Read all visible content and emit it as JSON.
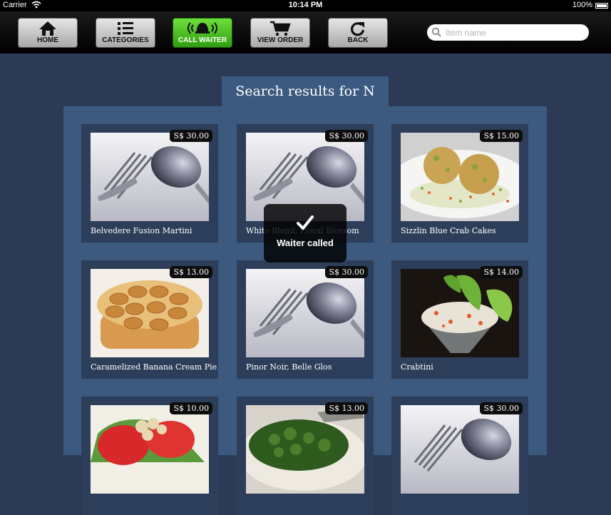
{
  "status_bar": {
    "carrier": "Carrier",
    "time": "10:14 PM",
    "battery": "100%"
  },
  "toolbar": {
    "home": "HOME",
    "categories": "CATEGORIES",
    "call_waiter": "CALL WAITER",
    "view_order": "VIEW ORDER",
    "back": "BACK"
  },
  "search": {
    "placeholder": "Item name"
  },
  "results": {
    "title": "Search results for N",
    "items": [
      {
        "name": "Belvedere Fusion Martini",
        "price": "S$ 30.00"
      },
      {
        "name": "White Blend, Floral Blossom",
        "price": "S$ 30.00"
      },
      {
        "name": "Sizzlin Blue Crab Cakes",
        "price": "S$ 15.00"
      },
      {
        "name": "Caramelized Banana Cream Pie",
        "price": "S$ 13.00"
      },
      {
        "name": "Pinor Noir, Belle Glos",
        "price": "S$ 30.00"
      },
      {
        "name": "Crabtini",
        "price": "S$ 14.00"
      },
      {
        "name": "",
        "price": "S$ 10.00"
      },
      {
        "name": "",
        "price": "S$ 13.00"
      },
      {
        "name": "",
        "price": "S$ 30.00"
      }
    ]
  },
  "toast": {
    "message": "Waiter called"
  },
  "colors": {
    "accent_green": "#4fc424",
    "panel": "#3c5a7f",
    "background": "#2c3a55"
  }
}
